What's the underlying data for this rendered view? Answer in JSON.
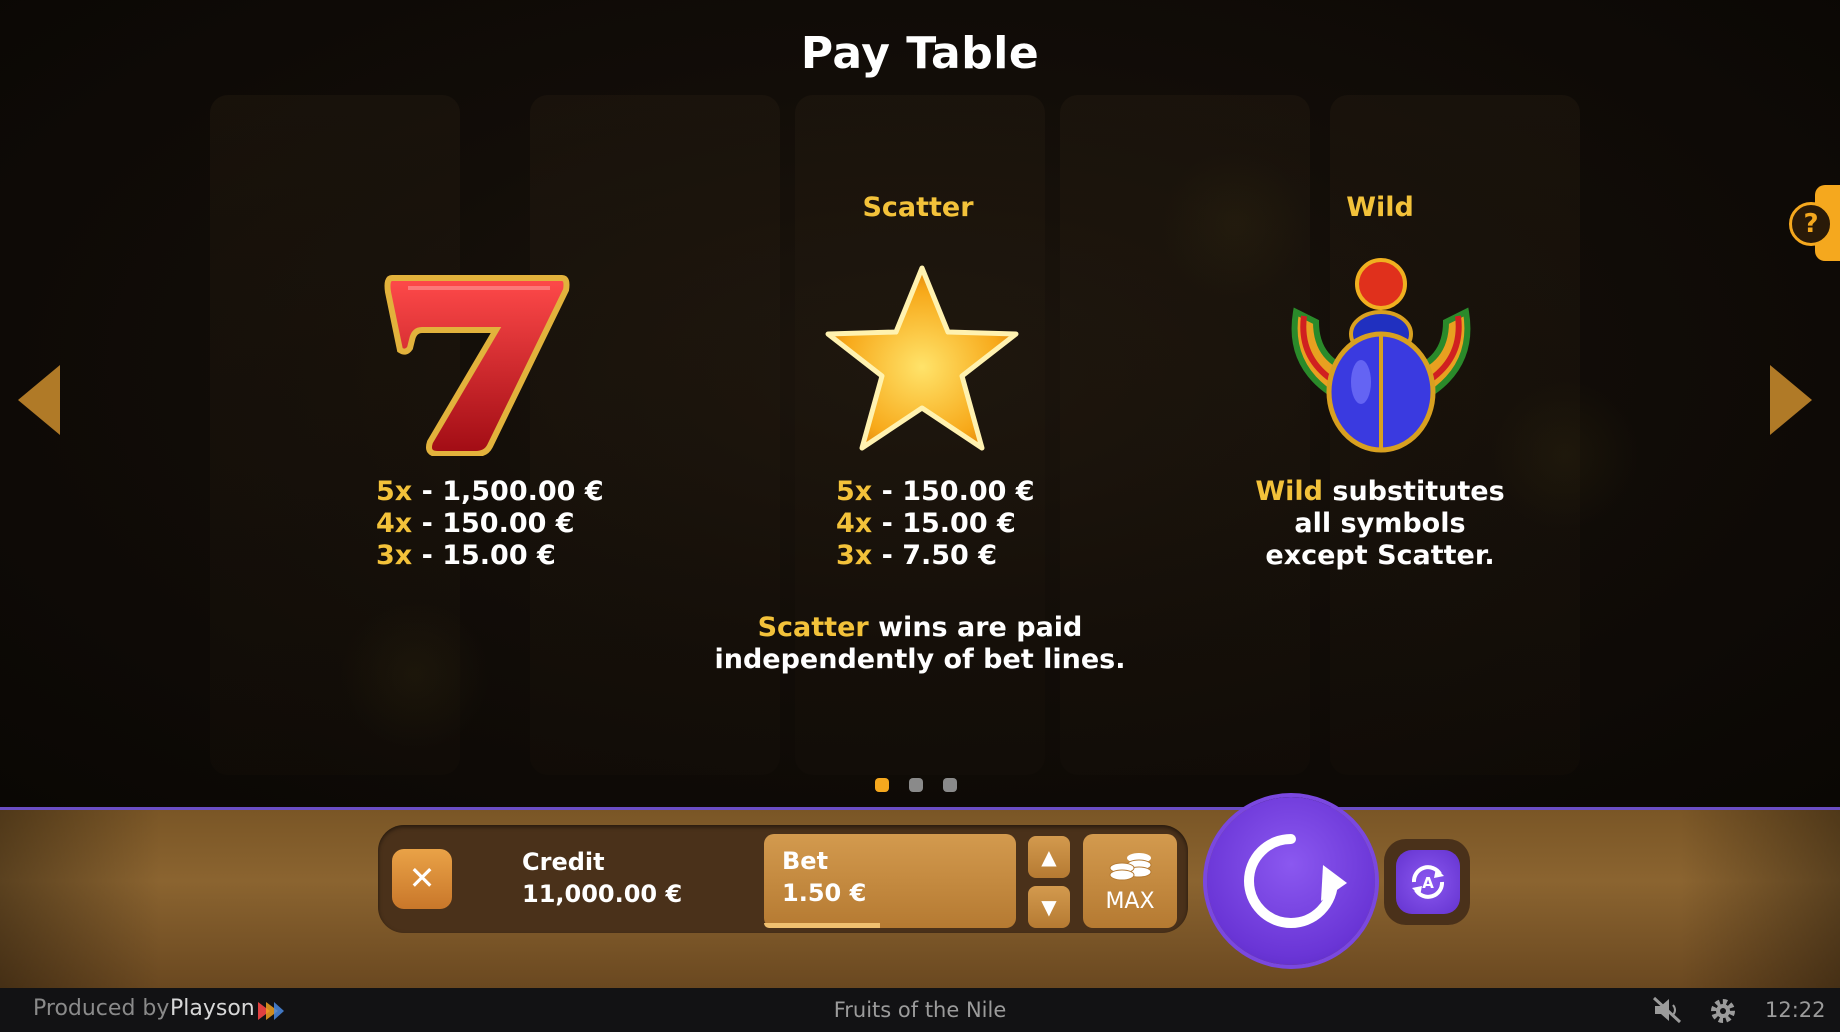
{
  "title": "Pay Table",
  "symbols": [
    {
      "name": "",
      "icon": "seven-icon",
      "payouts": [
        {
          "mult": "5x",
          "amount": " - 1,500.00 €"
        },
        {
          "mult": "4x",
          "amount": " - 150.00 €"
        },
        {
          "mult": "3x",
          "amount": " - 15.00 €"
        }
      ]
    },
    {
      "name": "Scatter",
      "icon": "star-icon",
      "payouts": [
        {
          "mult": "5x",
          "amount": " - 150.00 €"
        },
        {
          "mult": "4x",
          "amount": " - 15.00 €"
        },
        {
          "mult": "3x",
          "amount": " - 7.50 €"
        }
      ]
    },
    {
      "name": "Wild",
      "icon": "scarab-icon",
      "description": {
        "highlight": "Wild",
        "line1_rest": " substitutes",
        "line2": "all symbols",
        "line3": "except Scatter."
      }
    }
  ],
  "scatter_note": {
    "highlight": "Scatter",
    "line1_rest": " wins are paid",
    "line2": "independently of bet lines."
  },
  "pagination": {
    "pages": 3,
    "current": 1
  },
  "controls": {
    "close_symbol": "✕",
    "credit_label": "Credit",
    "credit_value": "11,000.00 €",
    "bet_label": "Bet",
    "bet_value": "1.50 €",
    "bet_progress": 0.46,
    "bet_up": "▲",
    "bet_down": "▼",
    "max_label": "MAX",
    "help_symbol": "?"
  },
  "footer": {
    "produced_by": "Produced by ",
    "brand": "Playson",
    "game_name": "Fruits of the Nile",
    "time": "12:22"
  },
  "colors": {
    "gold": "#f3c23a",
    "accent_purple": "#6a35d6",
    "bar_brown": "#8b6430",
    "dot_active": "#f5a81e",
    "dot_inactive": "#8a8a8a"
  }
}
